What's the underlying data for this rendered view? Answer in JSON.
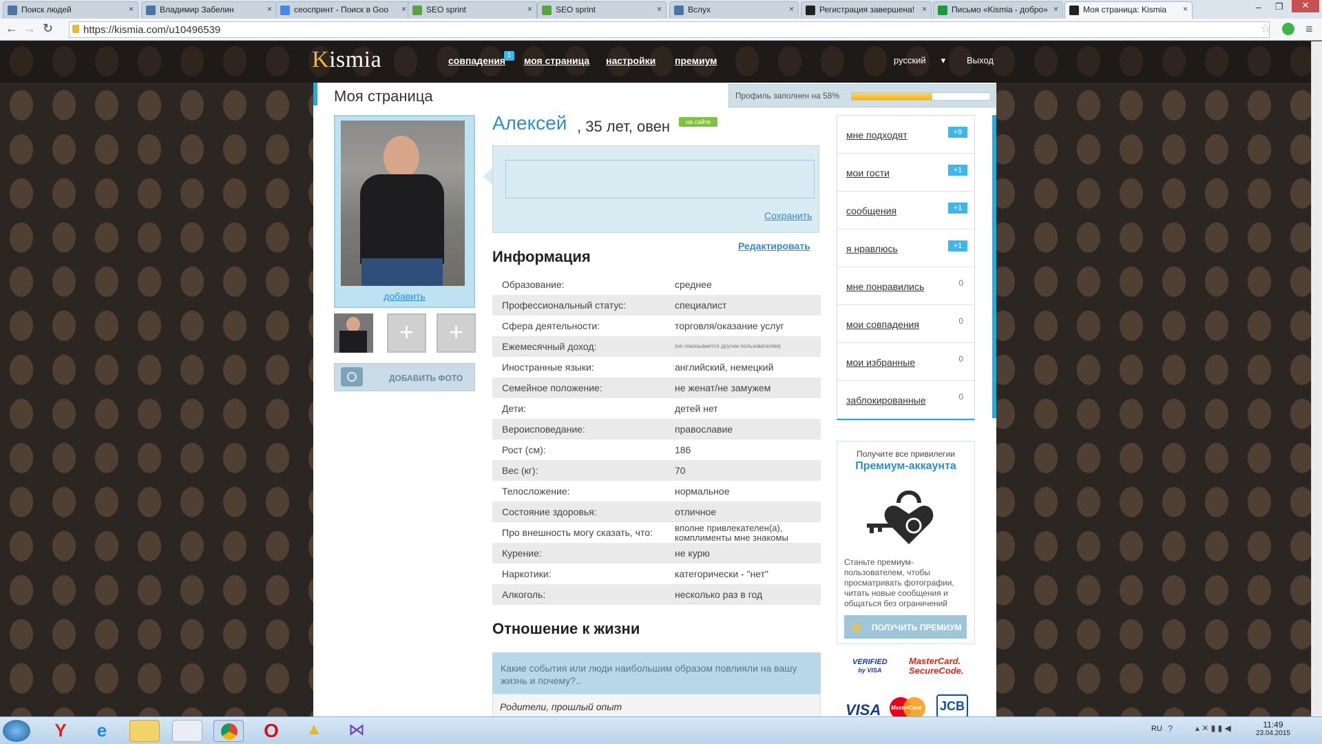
{
  "browser": {
    "tabs": [
      {
        "title": "Поиск людей",
        "icon": "vk-icon",
        "color": "#4c75a3"
      },
      {
        "title": "Владимир Забелин",
        "icon": "vk-icon",
        "color": "#4c75a3"
      },
      {
        "title": "сеоспринт - Поиск в Goo",
        "icon": "google-icon",
        "color": "#4285f4"
      },
      {
        "title": "SEO sprint",
        "icon": "seosprint-icon",
        "color": "#5aa43a"
      },
      {
        "title": "SEO sprint",
        "icon": "seosprint-icon",
        "color": "#5aa43a"
      },
      {
        "title": "Вслух",
        "icon": "vk-icon",
        "color": "#4c75a3"
      },
      {
        "title": "Регистрация завершена!",
        "icon": "kismia-icon",
        "color": "#222"
      },
      {
        "title": "Письмо «Kismia - добро»",
        "icon": "mail-icon",
        "color": "#1a9c3a"
      },
      {
        "title": "Моя страница: Kismia",
        "icon": "kismia-icon",
        "color": "#222"
      }
    ],
    "url": "https://kismia.com/u10496539"
  },
  "site": {
    "logo_first": "K",
    "logo_rest": "ismia",
    "nav": [
      "совпадения",
      "моя страница",
      "настройки",
      "премиум"
    ],
    "nav_badge": "1",
    "language": "русский",
    "logout": "Выход"
  },
  "page": {
    "title": "Моя страница",
    "progress_text": "Профиль заполнен на 58%",
    "progress_value": 0.58,
    "add_link": "добавить",
    "add_photo": "ДОБАВИТЬ ФОТО",
    "name": "Алексей",
    "name_rest": ", 35 лет, овен",
    "online": "на сайте",
    "save": "Сохранить",
    "edit": "Редактировать",
    "info_title": "Информация",
    "info": [
      {
        "label": "Образование:",
        "value": "среднее"
      },
      {
        "label": "Профессиональный статус:",
        "value": "специалист"
      },
      {
        "label": "Сфера деятельности:",
        "value": "торговля/оказание услуг"
      },
      {
        "label": "Ежемесячный доход:",
        "value": "(не показывается другим пользователям)"
      },
      {
        "label": "Иностранные языки:",
        "value": "английский, немецкий"
      },
      {
        "label": "Семейное положение:",
        "value": "не женат/не замужем"
      },
      {
        "label": "Дети:",
        "value": "детей нет"
      },
      {
        "label": "Вероисповедание:",
        "value": "православие"
      },
      {
        "label": "Рост (см):",
        "value": "186"
      },
      {
        "label": "Вес (кг):",
        "value": "70"
      },
      {
        "label": "Телосложение:",
        "value": "нормальное"
      },
      {
        "label": "Состояние здоровья:",
        "value": "отличное"
      },
      {
        "label": "Про внешность могу сказать, что:",
        "value": "вполне привлекателен(а), комплименты мне знакомы"
      },
      {
        "label": "Курение:",
        "value": "не курю"
      },
      {
        "label": "Наркотики:",
        "value": "категорически - \"нет\""
      },
      {
        "label": "Алкоголь:",
        "value": "несколько раз в год"
      }
    ],
    "life_title": "Отношение к жизни",
    "question": "Какие события или люди наибольшим образом повлияли на вашу жизнь и почему?..",
    "answer": "Родители, прошлый опыт"
  },
  "sidebar": {
    "items": [
      {
        "label": "мне подходят",
        "count": "+9"
      },
      {
        "label": "мои гости",
        "count": "+1"
      },
      {
        "label": "сообщения",
        "count": "+1"
      },
      {
        "label": "я нравлюсь",
        "count": "+1"
      },
      {
        "label": "мне понравились",
        "count": "0"
      },
      {
        "label": "мои совпадения",
        "count": "0"
      },
      {
        "label": "мои избранные",
        "count": "0"
      },
      {
        "label": "заблокированные",
        "count": "0"
      }
    ]
  },
  "premium": {
    "top": "Получите все привилегии",
    "title": "Премиум-аккаунта",
    "desc": "Станьте премиум-пользователем, чтобы просматривать фотографии, читать новые сообщения и общаться без ограничений",
    "button": "ПОЛУЧИТЬ ПРЕМИУМ",
    "verified_line1": "VERIFIED",
    "verified_line2": "by VISA",
    "mastercard_line1": "MasterCard.",
    "mastercard_line2": "SecureCode.",
    "visa": "VISA",
    "mastercard_logo": "MasterCard",
    "jcb": "JCB"
  },
  "taskbar": {
    "lang": "RU",
    "time": "11:49",
    "date": "23.04.2015"
  }
}
